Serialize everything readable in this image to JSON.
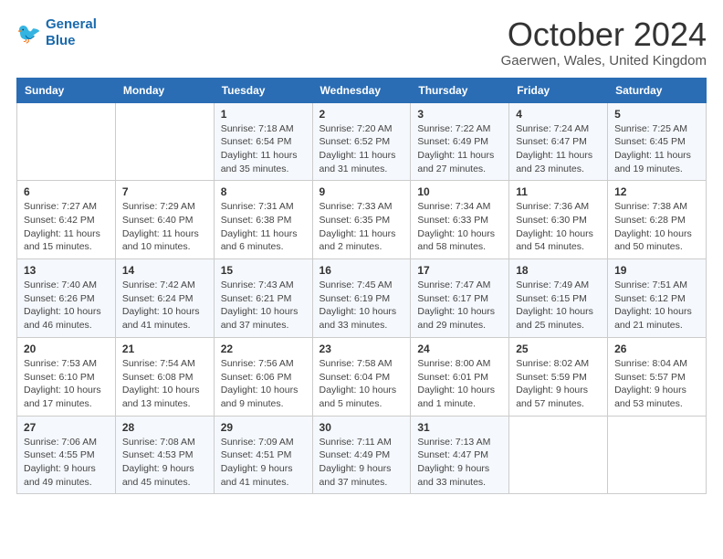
{
  "header": {
    "logo_line1": "General",
    "logo_line2": "Blue",
    "month": "October 2024",
    "location": "Gaerwen, Wales, United Kingdom"
  },
  "days_of_week": [
    "Sunday",
    "Monday",
    "Tuesday",
    "Wednesday",
    "Thursday",
    "Friday",
    "Saturday"
  ],
  "weeks": [
    [
      {
        "day": "",
        "info": ""
      },
      {
        "day": "",
        "info": ""
      },
      {
        "day": "1",
        "info": "Sunrise: 7:18 AM\nSunset: 6:54 PM\nDaylight: 11 hours and 35 minutes."
      },
      {
        "day": "2",
        "info": "Sunrise: 7:20 AM\nSunset: 6:52 PM\nDaylight: 11 hours and 31 minutes."
      },
      {
        "day": "3",
        "info": "Sunrise: 7:22 AM\nSunset: 6:49 PM\nDaylight: 11 hours and 27 minutes."
      },
      {
        "day": "4",
        "info": "Sunrise: 7:24 AM\nSunset: 6:47 PM\nDaylight: 11 hours and 23 minutes."
      },
      {
        "day": "5",
        "info": "Sunrise: 7:25 AM\nSunset: 6:45 PM\nDaylight: 11 hours and 19 minutes."
      }
    ],
    [
      {
        "day": "6",
        "info": "Sunrise: 7:27 AM\nSunset: 6:42 PM\nDaylight: 11 hours and 15 minutes."
      },
      {
        "day": "7",
        "info": "Sunrise: 7:29 AM\nSunset: 6:40 PM\nDaylight: 11 hours and 10 minutes."
      },
      {
        "day": "8",
        "info": "Sunrise: 7:31 AM\nSunset: 6:38 PM\nDaylight: 11 hours and 6 minutes."
      },
      {
        "day": "9",
        "info": "Sunrise: 7:33 AM\nSunset: 6:35 PM\nDaylight: 11 hours and 2 minutes."
      },
      {
        "day": "10",
        "info": "Sunrise: 7:34 AM\nSunset: 6:33 PM\nDaylight: 10 hours and 58 minutes."
      },
      {
        "day": "11",
        "info": "Sunrise: 7:36 AM\nSunset: 6:30 PM\nDaylight: 10 hours and 54 minutes."
      },
      {
        "day": "12",
        "info": "Sunrise: 7:38 AM\nSunset: 6:28 PM\nDaylight: 10 hours and 50 minutes."
      }
    ],
    [
      {
        "day": "13",
        "info": "Sunrise: 7:40 AM\nSunset: 6:26 PM\nDaylight: 10 hours and 46 minutes."
      },
      {
        "day": "14",
        "info": "Sunrise: 7:42 AM\nSunset: 6:24 PM\nDaylight: 10 hours and 41 minutes."
      },
      {
        "day": "15",
        "info": "Sunrise: 7:43 AM\nSunset: 6:21 PM\nDaylight: 10 hours and 37 minutes."
      },
      {
        "day": "16",
        "info": "Sunrise: 7:45 AM\nSunset: 6:19 PM\nDaylight: 10 hours and 33 minutes."
      },
      {
        "day": "17",
        "info": "Sunrise: 7:47 AM\nSunset: 6:17 PM\nDaylight: 10 hours and 29 minutes."
      },
      {
        "day": "18",
        "info": "Sunrise: 7:49 AM\nSunset: 6:15 PM\nDaylight: 10 hours and 25 minutes."
      },
      {
        "day": "19",
        "info": "Sunrise: 7:51 AM\nSunset: 6:12 PM\nDaylight: 10 hours and 21 minutes."
      }
    ],
    [
      {
        "day": "20",
        "info": "Sunrise: 7:53 AM\nSunset: 6:10 PM\nDaylight: 10 hours and 17 minutes."
      },
      {
        "day": "21",
        "info": "Sunrise: 7:54 AM\nSunset: 6:08 PM\nDaylight: 10 hours and 13 minutes."
      },
      {
        "day": "22",
        "info": "Sunrise: 7:56 AM\nSunset: 6:06 PM\nDaylight: 10 hours and 9 minutes."
      },
      {
        "day": "23",
        "info": "Sunrise: 7:58 AM\nSunset: 6:04 PM\nDaylight: 10 hours and 5 minutes."
      },
      {
        "day": "24",
        "info": "Sunrise: 8:00 AM\nSunset: 6:01 PM\nDaylight: 10 hours and 1 minute."
      },
      {
        "day": "25",
        "info": "Sunrise: 8:02 AM\nSunset: 5:59 PM\nDaylight: 9 hours and 57 minutes."
      },
      {
        "day": "26",
        "info": "Sunrise: 8:04 AM\nSunset: 5:57 PM\nDaylight: 9 hours and 53 minutes."
      }
    ],
    [
      {
        "day": "27",
        "info": "Sunrise: 7:06 AM\nSunset: 4:55 PM\nDaylight: 9 hours and 49 minutes."
      },
      {
        "day": "28",
        "info": "Sunrise: 7:08 AM\nSunset: 4:53 PM\nDaylight: 9 hours and 45 minutes."
      },
      {
        "day": "29",
        "info": "Sunrise: 7:09 AM\nSunset: 4:51 PM\nDaylight: 9 hours and 41 minutes."
      },
      {
        "day": "30",
        "info": "Sunrise: 7:11 AM\nSunset: 4:49 PM\nDaylight: 9 hours and 37 minutes."
      },
      {
        "day": "31",
        "info": "Sunrise: 7:13 AM\nSunset: 4:47 PM\nDaylight: 9 hours and 33 minutes."
      },
      {
        "day": "",
        "info": ""
      },
      {
        "day": "",
        "info": ""
      }
    ]
  ]
}
